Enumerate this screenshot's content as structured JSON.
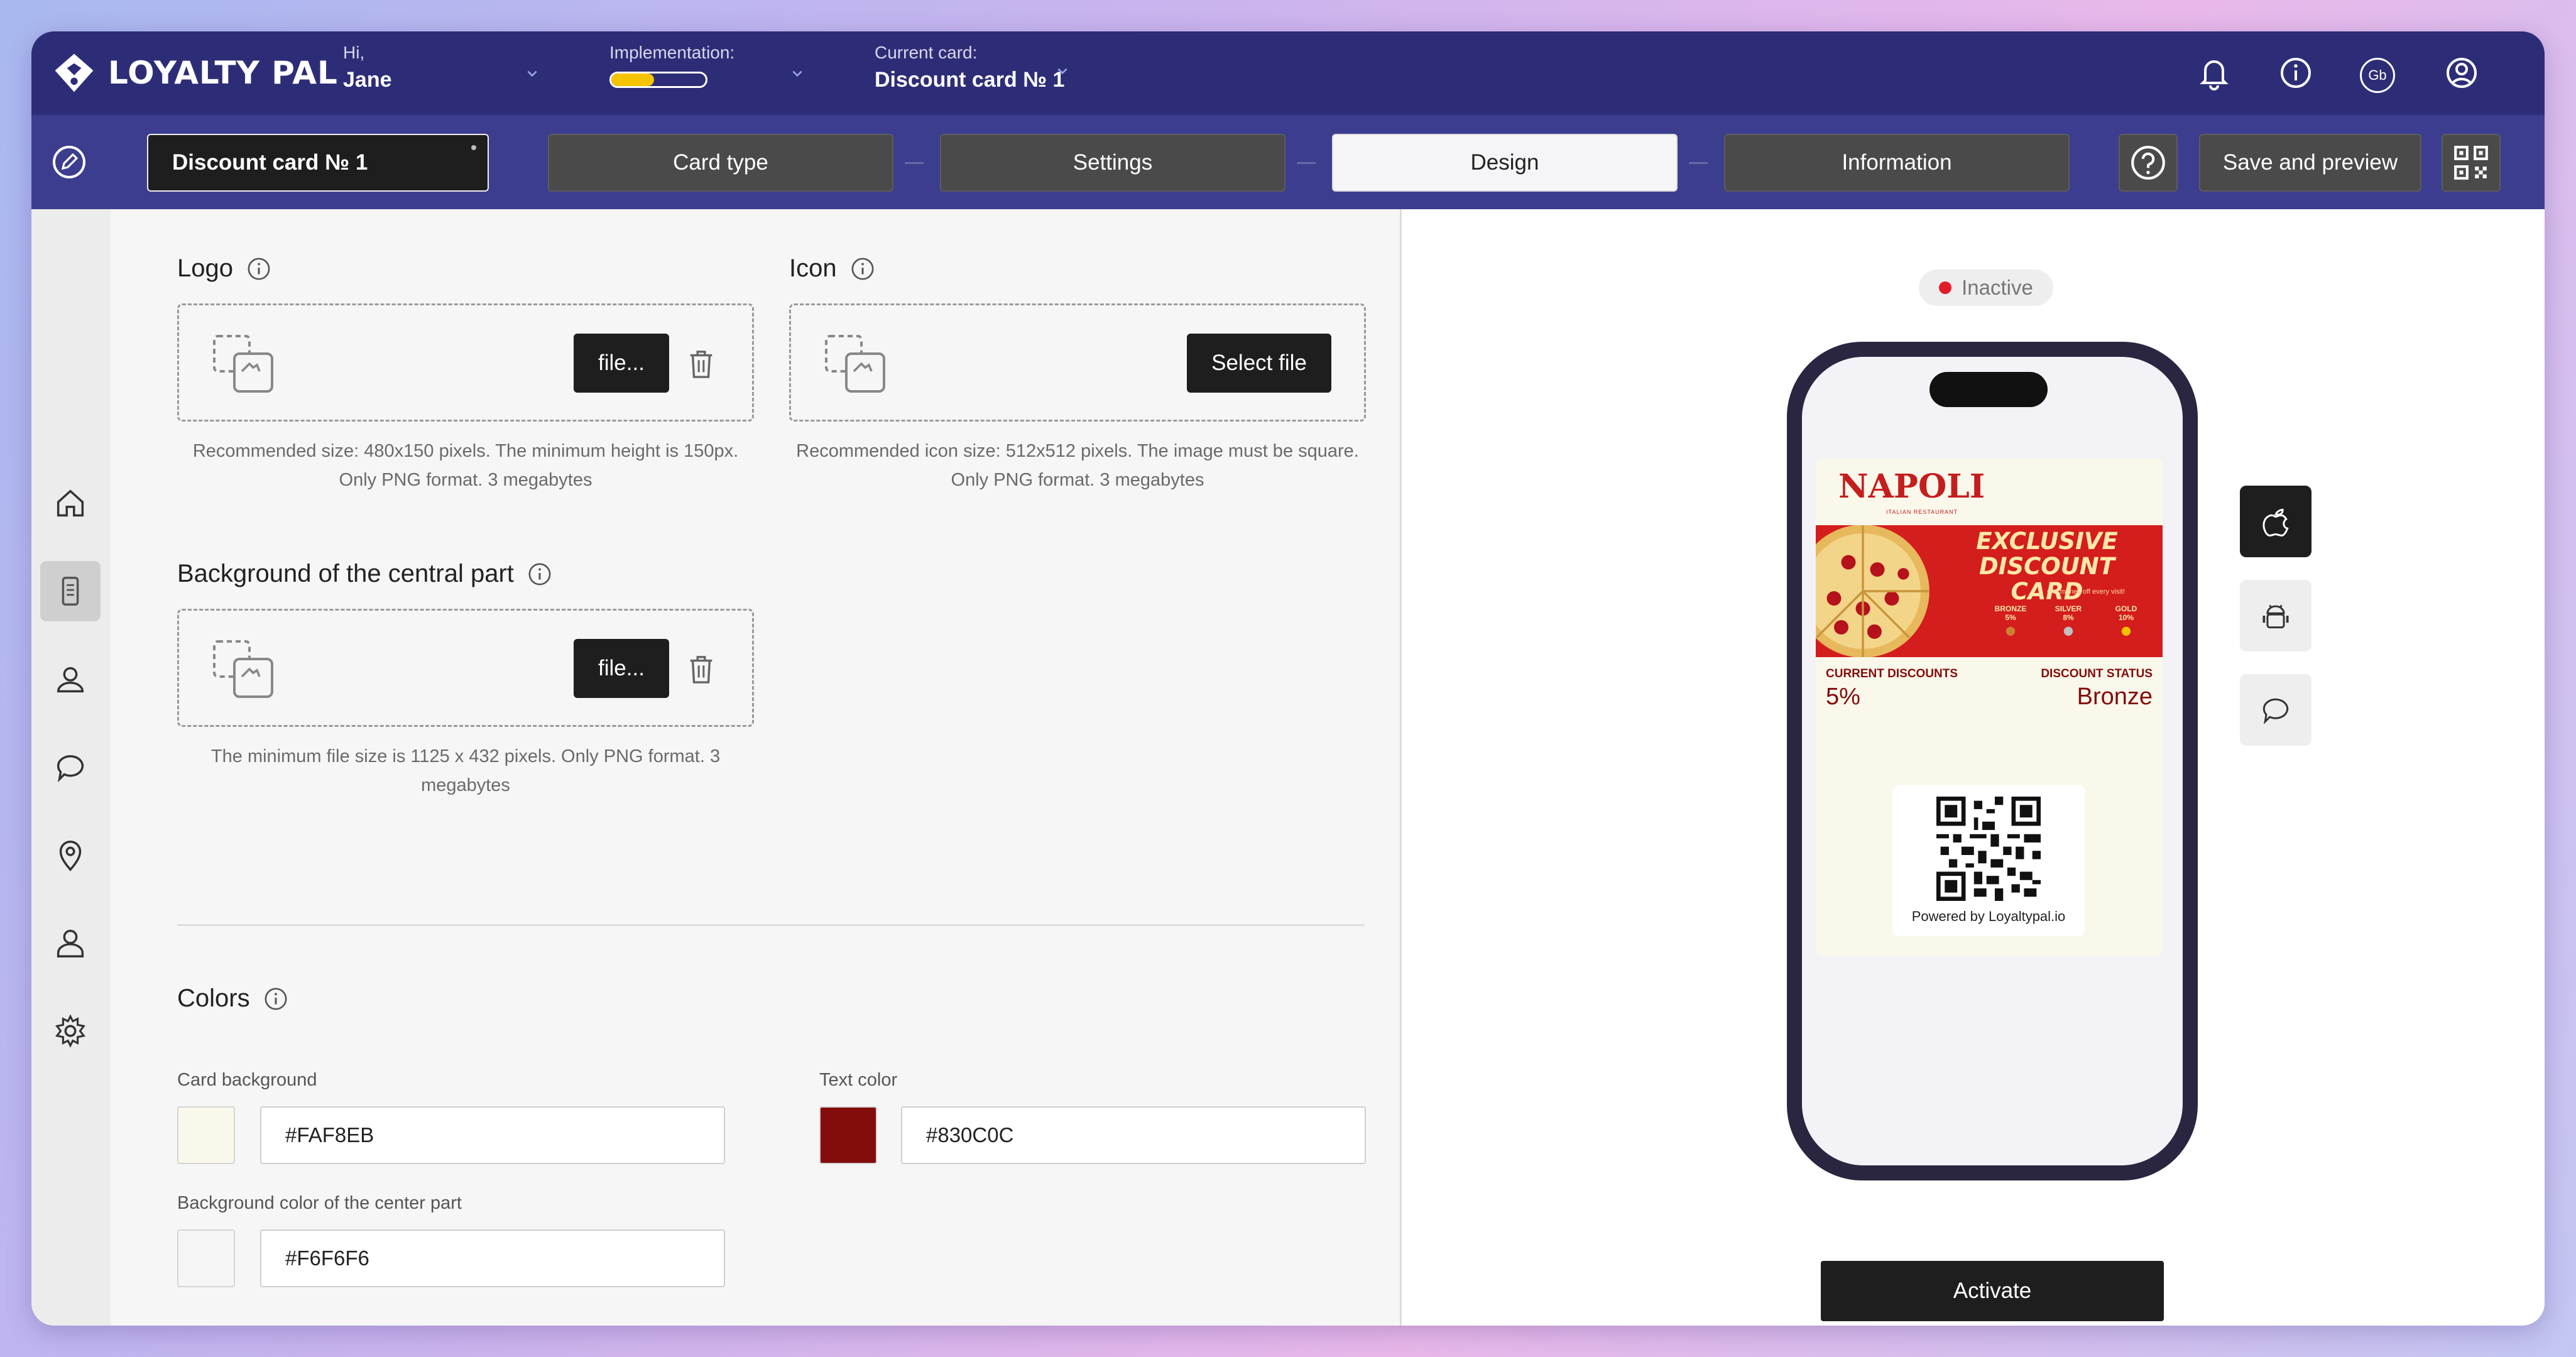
{
  "app": {
    "name": "LOYALTY PAL"
  },
  "header": {
    "greeting": "Hi,",
    "user_name": "Jane",
    "implementation_label": "Implementation:",
    "implementation_progress": 0.45,
    "current_card_label": "Current card:",
    "current_card_value": "Discount card № 1",
    "icons": [
      "bell-icon",
      "info-icon",
      "language-gb-icon",
      "account-icon"
    ],
    "language_code": "Gb"
  },
  "nav": {
    "card_name": "Discount card № 1",
    "tabs": [
      {
        "label": "Card type"
      },
      {
        "label": "Settings"
      },
      {
        "label": "Design"
      },
      {
        "label": "Information"
      }
    ],
    "active_tab": "Design",
    "save_preview_label": "Save and preview"
  },
  "sidebar": {
    "items": [
      "home-icon",
      "card-icon",
      "users-icon",
      "chat-icon",
      "location-icon",
      "profile-icon",
      "settings-icon"
    ],
    "active": "card-icon"
  },
  "editor": {
    "logo": {
      "title": "Logo",
      "button_label": "file...",
      "hint": "Recommended size: 480x150 pixels. The minimum height is 150px. Only PNG format. 3 megabytes"
    },
    "icon": {
      "title": "Icon",
      "button_label": "Select file",
      "hint": "Recommended icon size: 512x512 pixels. The image must be square. Only PNG format. 3 megabytes"
    },
    "background": {
      "title": "Background of the central part",
      "button_label": "file...",
      "hint": "The minimum file size is 1125 x 432 pixels. Only PNG format. 3 megabytes"
    },
    "colors": {
      "title": "Colors",
      "card_background_label": "Card background",
      "card_background_value": "#FAF8EB",
      "text_color_label": "Text color",
      "text_color_value": "#830C0C",
      "center_bg_label": "Background color of the center part",
      "center_bg_value": "#F6F6F6"
    }
  },
  "preview": {
    "status": "Inactive",
    "status_color": "#e01e2a",
    "pass": {
      "brand": "NAPOLI",
      "brand_sub": "ITALIAN RESTAURANT",
      "banner_title": "EXCLUSIVE DISCOUNT CARD",
      "banner_sub": "Get money off every visit!",
      "tiers": [
        {
          "name": "BRONZE",
          "pct": "5%"
        },
        {
          "name": "SILVER",
          "pct": "8%"
        },
        {
          "name": "GOLD",
          "pct": "10%"
        }
      ],
      "current_discounts_label": "CURRENT DISCOUNTS",
      "current_discounts_value": "5%",
      "discount_status_label": "DISCOUNT STATUS",
      "discount_status_value": "Bronze",
      "qr_caption": "Powered by Loyaltypal.io"
    },
    "platforms": [
      "apple-icon",
      "android-icon",
      "chat-bubble-icon"
    ],
    "active_platform": "apple-icon",
    "activate_label": "Activate"
  }
}
